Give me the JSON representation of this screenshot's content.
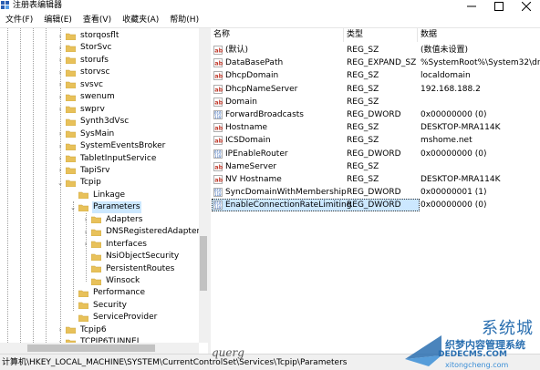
{
  "window": {
    "title": "注册表编辑器"
  },
  "menu": [
    "文件(F)",
    "编辑(E)",
    "查看(V)",
    "收藏夹(A)",
    "帮助(H)"
  ],
  "tree": {
    "items": [
      {
        "label": "storqosflt",
        "level": 0,
        "expander": "›",
        "selected": false
      },
      {
        "label": "StorSvc",
        "level": 0,
        "expander": "›",
        "selected": false
      },
      {
        "label": "storufs",
        "level": 0,
        "expander": "›",
        "selected": false
      },
      {
        "label": "storvsc",
        "level": 0,
        "expander": "›",
        "selected": false
      },
      {
        "label": "svsvc",
        "level": 0,
        "expander": "›",
        "selected": false
      },
      {
        "label": "swenum",
        "level": 0,
        "expander": "›",
        "selected": false
      },
      {
        "label": "swprv",
        "level": 0,
        "expander": "›",
        "selected": false
      },
      {
        "label": "Synth3dVsc",
        "level": 0,
        "expander": "",
        "selected": false
      },
      {
        "label": "SysMain",
        "level": 0,
        "expander": "›",
        "selected": false
      },
      {
        "label": "SystemEventsBroker",
        "level": 0,
        "expander": "›",
        "selected": false
      },
      {
        "label": "TabletInputService",
        "level": 0,
        "expander": "›",
        "selected": false
      },
      {
        "label": "TapiSrv",
        "level": 0,
        "expander": "›",
        "selected": false
      },
      {
        "label": "Tcpip",
        "level": 0,
        "expander": "⌄",
        "selected": false
      },
      {
        "label": "Linkage",
        "level": 1,
        "expander": "",
        "selected": false
      },
      {
        "label": "Parameters",
        "level": 1,
        "expander": "⌄",
        "selected": true
      },
      {
        "label": "Adapters",
        "level": 2,
        "expander": "›",
        "selected": false
      },
      {
        "label": "DNSRegisteredAdapters",
        "level": 2,
        "expander": "›",
        "selected": false
      },
      {
        "label": "Interfaces",
        "level": 2,
        "expander": "›",
        "selected": false
      },
      {
        "label": "NsiObjectSecurity",
        "level": 2,
        "expander": "",
        "selected": false
      },
      {
        "label": "PersistentRoutes",
        "level": 2,
        "expander": "",
        "selected": false
      },
      {
        "label": "Winsock",
        "level": 2,
        "expander": "",
        "selected": false
      },
      {
        "label": "Performance",
        "level": 1,
        "expander": "",
        "selected": false
      },
      {
        "label": "Security",
        "level": 1,
        "expander": "",
        "selected": false
      },
      {
        "label": "ServiceProvider",
        "level": 1,
        "expander": "",
        "selected": false
      },
      {
        "label": "Tcpip6",
        "level": 0,
        "expander": "›",
        "selected": false
      },
      {
        "label": "TCPIP6TUNNEL",
        "level": 0,
        "expander": "›",
        "selected": false
      }
    ]
  },
  "values": {
    "columns": [
      "名称",
      "类型",
      "数据"
    ],
    "rows": [
      {
        "name": "(默认)",
        "type": "REG_SZ",
        "data": "(数值未设置)",
        "icon": "string-value-icon",
        "selected": false
      },
      {
        "name": "DataBasePath",
        "type": "REG_EXPAND_SZ",
        "data": "%SystemRoot%\\System32\\drivers\\",
        "icon": "string-value-icon",
        "selected": false
      },
      {
        "name": "DhcpDomain",
        "type": "REG_SZ",
        "data": "localdomain",
        "icon": "string-value-icon",
        "selected": false
      },
      {
        "name": "DhcpNameServer",
        "type": "REG_SZ",
        "data": "192.168.188.2",
        "icon": "string-value-icon",
        "selected": false
      },
      {
        "name": "Domain",
        "type": "REG_SZ",
        "data": "",
        "icon": "string-value-icon",
        "selected": false
      },
      {
        "name": "ForwardBroadcasts",
        "type": "REG_DWORD",
        "data": "0x00000000 (0)",
        "icon": "binary-value-icon",
        "selected": false
      },
      {
        "name": "Hostname",
        "type": "REG_SZ",
        "data": "DESKTOP-MRA114K",
        "icon": "string-value-icon",
        "selected": false
      },
      {
        "name": "ICSDomain",
        "type": "REG_SZ",
        "data": "mshome.net",
        "icon": "string-value-icon",
        "selected": false
      },
      {
        "name": "IPEnableRouter",
        "type": "REG_DWORD",
        "data": "0x00000000 (0)",
        "icon": "binary-value-icon",
        "selected": false
      },
      {
        "name": "NameServer",
        "type": "REG_SZ",
        "data": "",
        "icon": "string-value-icon",
        "selected": false
      },
      {
        "name": "NV Hostname",
        "type": "REG_SZ",
        "data": "DESKTOP-MRA114K",
        "icon": "string-value-icon",
        "selected": false
      },
      {
        "name": "SyncDomainWithMembership",
        "type": "REG_DWORD",
        "data": "0x00000001 (1)",
        "icon": "binary-value-icon",
        "selected": false
      },
      {
        "name": "EnableConnectionRateLimiting",
        "type": "REG_DWORD",
        "data": "0x00000000 (0)",
        "icon": "binary-value-icon",
        "selected": true
      }
    ]
  },
  "status": {
    "path": "计算机\\HKEY_LOCAL_MACHINE\\SYSTEM\\CurrentControlSet\\Services\\Tcpip\\Parameters"
  },
  "overlay": {
    "signature": "querg",
    "watermark_brand": "系统城",
    "watermark_line1": "织梦内容管理系统",
    "watermark_line2": "DEDECMS.COM",
    "watermark_line3": "xitongcheng.com"
  },
  "colors": {
    "selection": "#cce8ff",
    "folder": "#e8c15a",
    "string_icon": "#c0392b",
    "binary_icon": "#2b5fb3",
    "watermark": "#2a6fb0"
  }
}
